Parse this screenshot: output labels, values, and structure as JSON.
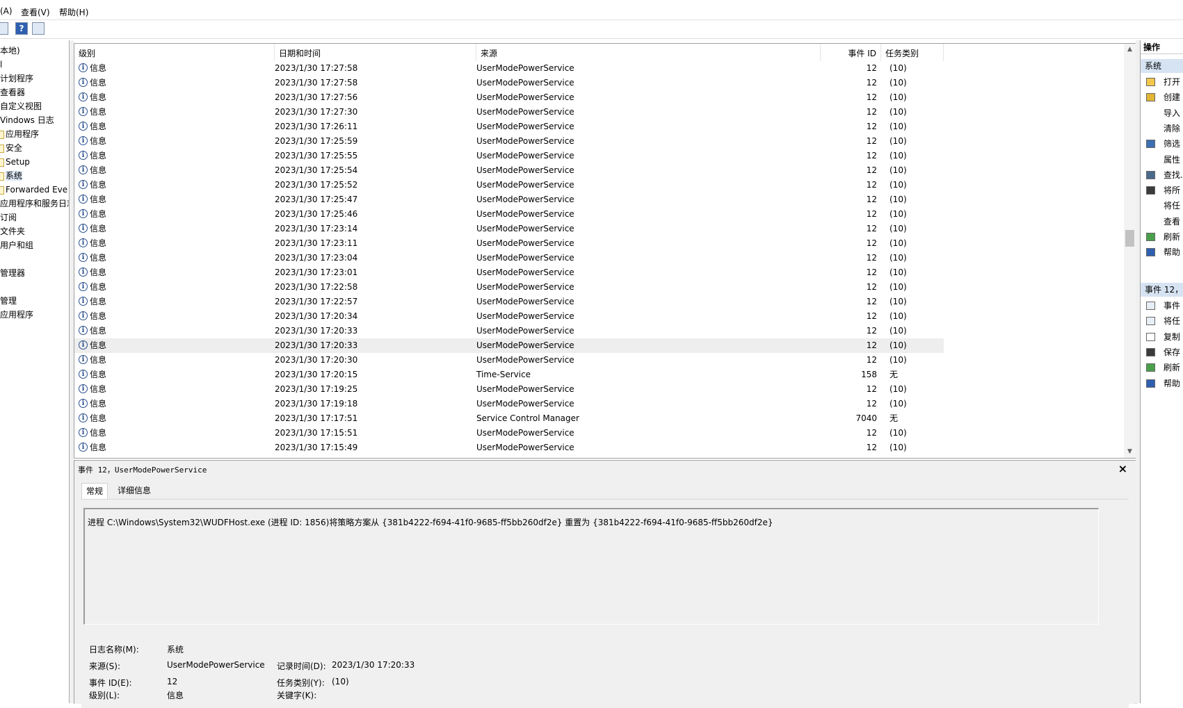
{
  "menu": {
    "action": "(A)",
    "view": "查看(V)",
    "help": "帮助(H)"
  },
  "tree": [
    {
      "label": "本地)",
      "indent": 0
    },
    {
      "label": "l",
      "indent": 0
    },
    {
      "label": "计划程序",
      "indent": 0
    },
    {
      "label": "查看器",
      "indent": 0
    },
    {
      "label": "自定义视图",
      "indent": 0
    },
    {
      "label": "Vindows 日志",
      "indent": 0
    },
    {
      "label": "应用程序",
      "indent": 1
    },
    {
      "label": "安全",
      "indent": 1
    },
    {
      "label": "Setup",
      "indent": 1
    },
    {
      "label": "系统",
      "indent": 1,
      "selected": true
    },
    {
      "label": "Forwarded Eve",
      "indent": 1
    },
    {
      "label": "应用程序和服务日志",
      "indent": 0
    },
    {
      "label": "订阅",
      "indent": 0
    },
    {
      "label": "文件夹",
      "indent": 0
    },
    {
      "label": "用户和组",
      "indent": 0
    },
    {
      "label": "",
      "indent": 0
    },
    {
      "label": "管理器",
      "indent": 0
    },
    {
      "label": "",
      "indent": 0
    },
    {
      "label": "管理",
      "indent": 0
    },
    {
      "label": "应用程序",
      "indent": 0
    }
  ],
  "columns": {
    "level": "级别",
    "datetime": "日期和时间",
    "source": "来源",
    "event_id": "事件 ID",
    "category": "任务类别"
  },
  "events": [
    {
      "level": "信息",
      "datetime": "2023/1/30 17:27:58",
      "source": "UserModePowerService",
      "id": "12",
      "category": "(10)"
    },
    {
      "level": "信息",
      "datetime": "2023/1/30 17:27:58",
      "source": "UserModePowerService",
      "id": "12",
      "category": "(10)"
    },
    {
      "level": "信息",
      "datetime": "2023/1/30 17:27:56",
      "source": "UserModePowerService",
      "id": "12",
      "category": "(10)"
    },
    {
      "level": "信息",
      "datetime": "2023/1/30 17:27:30",
      "source": "UserModePowerService",
      "id": "12",
      "category": "(10)"
    },
    {
      "level": "信息",
      "datetime": "2023/1/30 17:26:11",
      "source": "UserModePowerService",
      "id": "12",
      "category": "(10)"
    },
    {
      "level": "信息",
      "datetime": "2023/1/30 17:25:59",
      "source": "UserModePowerService",
      "id": "12",
      "category": "(10)"
    },
    {
      "level": "信息",
      "datetime": "2023/1/30 17:25:55",
      "source": "UserModePowerService",
      "id": "12",
      "category": "(10)"
    },
    {
      "level": "信息",
      "datetime": "2023/1/30 17:25:54",
      "source": "UserModePowerService",
      "id": "12",
      "category": "(10)"
    },
    {
      "level": "信息",
      "datetime": "2023/1/30 17:25:52",
      "source": "UserModePowerService",
      "id": "12",
      "category": "(10)"
    },
    {
      "level": "信息",
      "datetime": "2023/1/30 17:25:47",
      "source": "UserModePowerService",
      "id": "12",
      "category": "(10)"
    },
    {
      "level": "信息",
      "datetime": "2023/1/30 17:25:46",
      "source": "UserModePowerService",
      "id": "12",
      "category": "(10)"
    },
    {
      "level": "信息",
      "datetime": "2023/1/30 17:23:14",
      "source": "UserModePowerService",
      "id": "12",
      "category": "(10)"
    },
    {
      "level": "信息",
      "datetime": "2023/1/30 17:23:11",
      "source": "UserModePowerService",
      "id": "12",
      "category": "(10)"
    },
    {
      "level": "信息",
      "datetime": "2023/1/30 17:23:04",
      "source": "UserModePowerService",
      "id": "12",
      "category": "(10)"
    },
    {
      "level": "信息",
      "datetime": "2023/1/30 17:23:01",
      "source": "UserModePowerService",
      "id": "12",
      "category": "(10)"
    },
    {
      "level": "信息",
      "datetime": "2023/1/30 17:22:58",
      "source": "UserModePowerService",
      "id": "12",
      "category": "(10)"
    },
    {
      "level": "信息",
      "datetime": "2023/1/30 17:22:57",
      "source": "UserModePowerService",
      "id": "12",
      "category": "(10)"
    },
    {
      "level": "信息",
      "datetime": "2023/1/30 17:20:34",
      "source": "UserModePowerService",
      "id": "12",
      "category": "(10)"
    },
    {
      "level": "信息",
      "datetime": "2023/1/30 17:20:33",
      "source": "UserModePowerService",
      "id": "12",
      "category": "(10)"
    },
    {
      "level": "信息",
      "datetime": "2023/1/30 17:20:33",
      "source": "UserModePowerService",
      "id": "12",
      "category": "(10)",
      "selected": true
    },
    {
      "level": "信息",
      "datetime": "2023/1/30 17:20:30",
      "source": "UserModePowerService",
      "id": "12",
      "category": "(10)"
    },
    {
      "level": "信息",
      "datetime": "2023/1/30 17:20:15",
      "source": "Time-Service",
      "id": "158",
      "category": "无"
    },
    {
      "level": "信息",
      "datetime": "2023/1/30 17:19:25",
      "source": "UserModePowerService",
      "id": "12",
      "category": "(10)"
    },
    {
      "level": "信息",
      "datetime": "2023/1/30 17:19:18",
      "source": "UserModePowerService",
      "id": "12",
      "category": "(10)"
    },
    {
      "level": "信息",
      "datetime": "2023/1/30 17:17:51",
      "source": "Service Control Manager",
      "id": "7040",
      "category": "无"
    },
    {
      "level": "信息",
      "datetime": "2023/1/30 17:15:51",
      "source": "UserModePowerService",
      "id": "12",
      "category": "(10)"
    },
    {
      "level": "信息",
      "datetime": "2023/1/30 17:15:49",
      "source": "UserModePowerService",
      "id": "12",
      "category": "(10)"
    }
  ],
  "detail": {
    "title": "事件 12，UserModePowerService",
    "close": "×",
    "tab_general": "常规",
    "tab_details": "详细信息",
    "message": "进程 C:\\Windows\\System32\\WUDFHost.exe (进程 ID: 1856)将策略方案从 {381b4222-f694-41f0-9685-ff5bb260df2e} 重置为 {381b4222-f694-41f0-9685-ff5bb260df2e}",
    "log_name_label": "日志名称(M):",
    "log_name": "系统",
    "source_label": "来源(S):",
    "source": "UserModePowerService",
    "logged_label": "记录时间(D):",
    "logged": "2023/1/30 17:20:33",
    "event_id_label": "事件 ID(E):",
    "event_id": "12",
    "category_label": "任务类别(Y):",
    "category": "(10)",
    "level_label": "级别(L):",
    "level": "信息",
    "keywords_label": "关键字(K):"
  },
  "actions": {
    "header": "操作",
    "group1": "系统",
    "items1": [
      "打开",
      "创建",
      "导入",
      "清除",
      "筛选",
      "属性",
      "查找...",
      "将所",
      "将任",
      "查看",
      "刷新",
      "帮助"
    ],
    "group2": "事件 12，",
    "items2": [
      "事件",
      "将任",
      "复制",
      "保存",
      "刷新",
      "帮助"
    ]
  }
}
